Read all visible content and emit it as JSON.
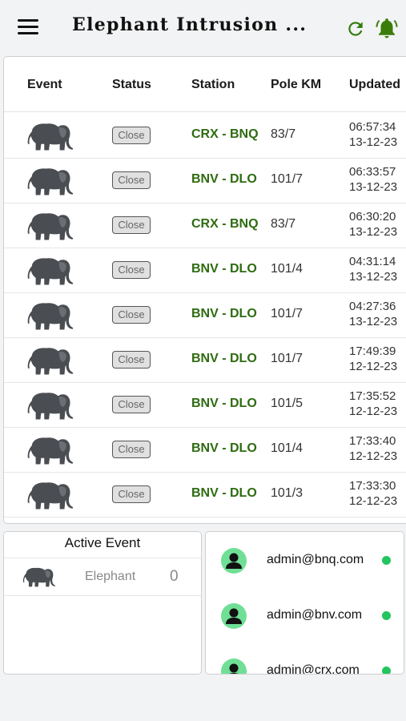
{
  "app": {
    "title": "Elephant Intrusion ..."
  },
  "colors": {
    "station_green": "#2e6b10",
    "avatar_green": "#6fdf96",
    "online_green": "#22c55e",
    "bell_green": "#3a7d0a"
  },
  "icons": {
    "menu": "menu-icon",
    "refresh": "refresh-icon",
    "bell": "bell-icon",
    "event": "elephant-icon",
    "user": "user-icon"
  },
  "table": {
    "headers": {
      "event": "Event",
      "status": "Status",
      "station": "Station",
      "pole": "Pole KM",
      "updated": "Updated"
    },
    "rows": [
      {
        "status": "Close",
        "station": "CRX - BNQ",
        "pole": "83/7",
        "time": "06:57:34",
        "date": "13-12-23"
      },
      {
        "status": "Close",
        "station": "BNV - DLO",
        "pole": "101/7",
        "time": "06:33:57",
        "date": "13-12-23"
      },
      {
        "status": "Close",
        "station": "CRX - BNQ",
        "pole": "83/7",
        "time": "06:30:20",
        "date": "13-12-23"
      },
      {
        "status": "Close",
        "station": "BNV - DLO",
        "pole": "101/4",
        "time": "04:31:14",
        "date": "13-12-23"
      },
      {
        "status": "Close",
        "station": "BNV - DLO",
        "pole": "101/7",
        "time": "04:27:36",
        "date": "13-12-23"
      },
      {
        "status": "Close",
        "station": "BNV - DLO",
        "pole": "101/7",
        "time": "17:49:39",
        "date": "12-12-23"
      },
      {
        "status": "Close",
        "station": "BNV - DLO",
        "pole": "101/5",
        "time": "17:35:52",
        "date": "12-12-23"
      },
      {
        "status": "Close",
        "station": "BNV - DLO",
        "pole": "101/4",
        "time": "17:33:40",
        "date": "12-12-23"
      },
      {
        "status": "Close",
        "station": "BNV - DLO",
        "pole": "101/3",
        "time": "17:33:30",
        "date": "12-12-23"
      }
    ]
  },
  "active_event": {
    "title": "Active Event",
    "label": "Elephant",
    "count": "0"
  },
  "users": [
    {
      "email": "admin@bnq.com"
    },
    {
      "email": "admin@bnv.com"
    },
    {
      "email": "admin@crx.com"
    }
  ]
}
